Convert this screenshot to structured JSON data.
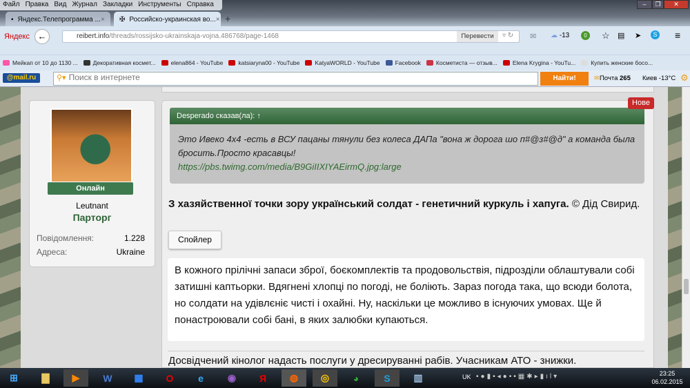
{
  "menu": [
    "Файл",
    "Правка",
    "Вид",
    "Журнал",
    "Закладки",
    "Инструменты",
    "Справка"
  ],
  "tabs": [
    {
      "label": "Яндекс.Телепрограмма ..."
    },
    {
      "label": "Российско-украинская во..."
    }
  ],
  "nav": {
    "brand": "Яндекс",
    "url_domain": "reibert.info",
    "url_path": "/threads/rossijsko-ukrainskaja-vojna.486768/page-1468",
    "translate": "Перевести",
    "weather": "-13",
    "badge": "0"
  },
  "bookmarks": [
    "Мейкап от 10 до 1130 ...",
    "Декоративная космет...",
    "elena864 - YouTube",
    "katsiaryna00 - YouTube",
    "KatyaWORLD - YouTube",
    "Facebook",
    "Косметиста — отзыв...",
    "Elena Krygina - YouTu...",
    "Купить женские босо..."
  ],
  "mailbar": {
    "logo": "@mail.ru",
    "placeholder": "Поиск в интернете",
    "search_btn": "Найти!",
    "mail": "Почта",
    "mail_count": "265",
    "city": "Киев -13°C"
  },
  "user": {
    "status": "Онлайн",
    "name": "Leutnant",
    "title": "Парторг",
    "posts_label": "Повідомлення:",
    "posts": "1.228",
    "addr_label": "Адреса:",
    "addr": "Ukraine"
  },
  "post": {
    "badge": "Нове",
    "quote_head": "Desperado сказав(ла): ↑",
    "quote_text": "Это Ивеко 4х4 -есть в ВСУ пацаны тянули без колеса ДАПа \"вона ж дорога шо п#@з#@д\" а команда была бросить.Просто красавцы!",
    "quote_link": "https://pbs.twimg.com/media/B9GiIIXIYAEirmQ.jpg:large",
    "headline_bold": "З хазяйственної точки зору український солдат - генетичний куркуль і хапуга.",
    "headline_rest": " © Дід Свирид.",
    "spoiler": "Спойлер",
    "spoiler_text": "В кожного прілічні запаси зброї, боєкомплектів та продовольствія, підрозділи облаштували собі затишні каптьорки. Вдягнені хлопці по погоді, не боліють. Зараз погода така, що всюди болота, но солдати на удівлєніє чисті і охайні. Ну, наскільки це можливо в існуючих умовах. Ще й понастроювали собі бані, в яких залюбки купаються.",
    "footer": "Досвідчений кінолог надасть послуги у дресируванні рабів. Учасникам АТО - знижки."
  },
  "taskbar": {
    "lang": "UK",
    "time": "23:25",
    "date": "06.02.2015"
  }
}
